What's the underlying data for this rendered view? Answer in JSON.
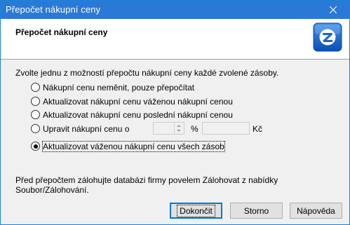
{
  "window": {
    "title": "Přepočet nákupní ceny"
  },
  "header": {
    "heading": "Přepočet nákupní ceny",
    "logo_icon": "pohoda-logo-icon"
  },
  "intro": "Zvolte jednu z možností přepočtu nákupní ceny každé zvolené zásoby.",
  "options": [
    {
      "label": "Nákupní cenu neměnit, pouze přepočítat",
      "checked": false
    },
    {
      "label": "Aktualizovat nákupní cenu váženou nákupní cenou",
      "checked": false
    },
    {
      "label": "Aktualizovat nákupní cenu poslední nákupní cenou",
      "checked": false
    },
    {
      "label": "Upravit nákupní cenu o",
      "checked": false
    },
    {
      "label": "Aktualizovat váženou nákupní cenu všech zásob",
      "checked": true
    }
  ],
  "adjust": {
    "percent_value": "",
    "percent_unit": "%",
    "amount_value": "",
    "currency": "Kč"
  },
  "note": "Před přepočtem zálohujte databázi firmy povelem Zálohovat z nabídky Soubor/Zálohování.",
  "buttons": {
    "ok": "Dokončit",
    "cancel": "Storno",
    "help": "Nápověda"
  },
  "colors": {
    "titlebar": "#2b79d7",
    "default_button_border": "#0078d7"
  }
}
